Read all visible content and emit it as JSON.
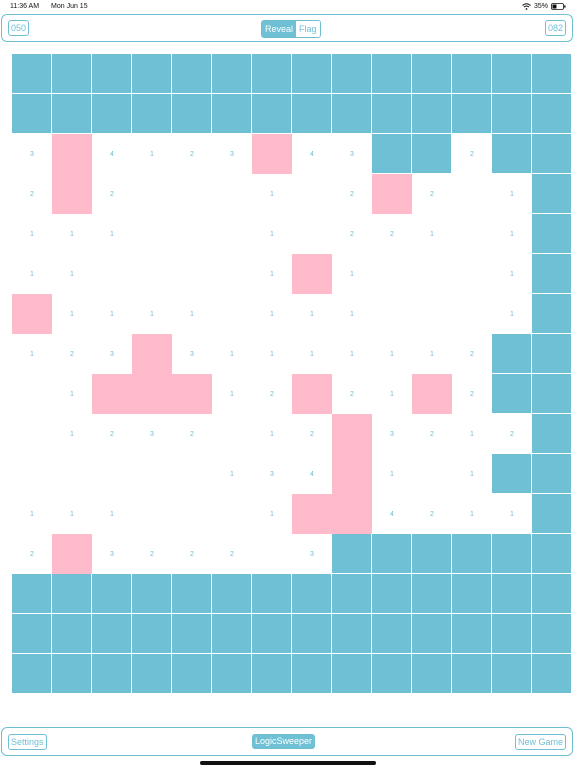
{
  "status": {
    "time": "11:36 AM",
    "date": "Mon Jun 15",
    "battery": "35%",
    "icons": [
      "wifi-icon",
      "battery-icon"
    ]
  },
  "header": {
    "mine_count": "050",
    "mode_options": [
      "Reveal",
      "Flag"
    ],
    "active_mode": "Reveal",
    "timer": "082"
  },
  "footer": {
    "settings_label": "Settings",
    "title_label": "LogicSweeper",
    "new_game_label": "New Game"
  },
  "colors": {
    "accent": "#6fc0d5",
    "flag": "#ffbbcc",
    "background": "#ffffff"
  },
  "board": {
    "columns": 14,
    "rows": 16,
    "legend": {
      "#": "hidden",
      "F": "flag",
      ".": "open empty",
      "1-9": "open number"
    },
    "cells": [
      "##############",
      "##############",
      "3F4123F43##2##",
      "2F2...1.2F2.1##",
      "111...1.221.1##",
      "11....1F1...1##",
      "F1111.111...1##",
      "123F31111112##",
      ".1FFF12F21F2##",
      ".1232.12F3212##",
      ".....134F1.1##",
      "111...1FF4211##",
      "2F3222.3#######",
      "##############",
      "##############",
      "##############"
    ]
  }
}
